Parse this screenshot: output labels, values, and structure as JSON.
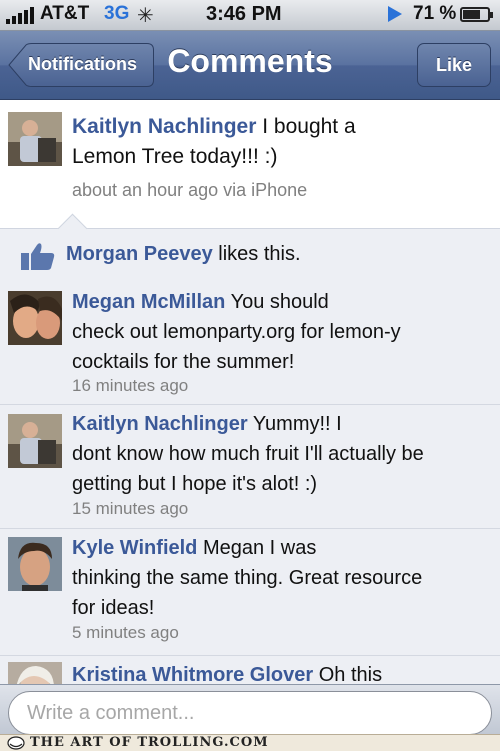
{
  "status_bar": {
    "carrier": "AT&T",
    "network": "3G",
    "time": "3:46 PM",
    "battery": "71 %",
    "battery_level": 0.71
  },
  "nav": {
    "back_label": "Notifications",
    "title": "Comments",
    "like_label": "Like"
  },
  "post": {
    "author": "Kaitlyn Nachlinger",
    "text_line1": "I bought a",
    "text_line2": "Lemon Tree today!!! :)",
    "meta": "about an hour ago via iPhone"
  },
  "likes": {
    "name": "Morgan Peevey",
    "suffix": "likes this."
  },
  "comments": [
    {
      "author": "Megan McMillan",
      "line1": "You should",
      "line2": "check out lemonparty.org for lemon-y",
      "line3": "cocktails for the summer!",
      "time": "16 minutes ago"
    },
    {
      "author": "Kaitlyn Nachlinger",
      "line1": "Yummy!! I",
      "line2": "dont know how much fruit I'll actually be",
      "line3": "getting but I hope it's alot! :)",
      "time": "15 minutes ago"
    },
    {
      "author": "Kyle Winfield",
      "line1": "Megan I was",
      "line2": "thinking the same thing. Great resource",
      "line3": "for ideas!",
      "time": "5 minutes ago"
    },
    {
      "author": "Kristina Whitmore Glover",
      "line1": "Oh this"
    }
  ],
  "composer": {
    "placeholder": "Write a comment..."
  },
  "watermark": "THE ART OF TROLLING.COM",
  "colors": {
    "link_blue": "#3b5998",
    "nav_blue": "#4b6394",
    "comment_bg": "#edeff4"
  }
}
